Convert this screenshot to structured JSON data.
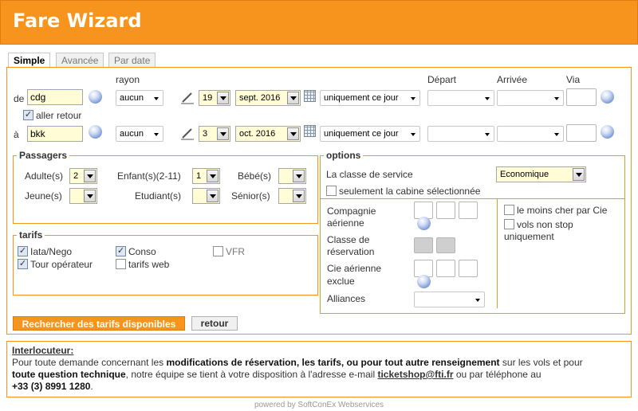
{
  "header": {
    "title": "Fare Wizard"
  },
  "tabs": [
    "Simple",
    "Avancée",
    "Par date"
  ],
  "columns": {
    "rayon": "rayon",
    "depart": "Départ",
    "arrivee": "Arrivée",
    "via": "Via"
  },
  "outbound": {
    "label": "de",
    "origin": "cdg",
    "rayon": "aucun",
    "day": "19",
    "month": "sept. 2016",
    "flex": "uniquement ce jour",
    "return_trip_label": "aller retour",
    "return_trip_checked": true
  },
  "inbound": {
    "label": "à",
    "origin": "bkk",
    "rayon": "aucun",
    "day": "3",
    "month": "oct. 2016",
    "flex": "uniquement ce jour"
  },
  "passengers": {
    "legend": "Passagers",
    "adults_label": "Adulte(s)",
    "adults": "2",
    "children_label": "Enfant(s)(2-11)",
    "children": "1",
    "babies_label": "Bébé(s)",
    "babies": "",
    "youth_label": "Jeune(s)",
    "youth": "",
    "students_label": "Etudiant(s)",
    "students": "",
    "seniors_label": "Sénior(s)",
    "seniors": ""
  },
  "options": {
    "legend": "options",
    "service_class_label": "La classe de service",
    "service_class": "Economique",
    "cabin_only_label": "seulement la cabine sélectionnée",
    "airline_label_1": "Compagnie",
    "airline_label_2": "aérienne",
    "booking_class_label_1": "Classe de",
    "booking_class_label_2": "réservation",
    "excluded_label_1": "Cie aérienne",
    "excluded_label_2": "exclue",
    "alliances_label": "Alliances",
    "cheapest_label": "le moins cher par Cie",
    "nonstop_label_1": "vols non stop",
    "nonstop_label_2": "uniquement"
  },
  "fares": {
    "legend": "tarifs",
    "items": [
      {
        "label": "Iata/Nego",
        "checked": true
      },
      {
        "label": "Conso",
        "checked": true
      },
      {
        "label": "VFR",
        "checked": false
      },
      {
        "label": "Tour opérateur",
        "checked": true
      },
      {
        "label": "tarifs web",
        "checked": false
      }
    ]
  },
  "buttons": {
    "search": "Rechercher des tarifs disponibles",
    "back": "retour"
  },
  "info": {
    "title": "Interlocuteur:",
    "p1": "Pour toute demande concernant les ",
    "b1": "modifications de réservation, les tarifs, ou pour tout autre renseignement",
    "p2": " sur les vols et pour",
    "b2": "toute question technique",
    "p3": ", notre équipe se tient à votre disposition à l'adresse e-mail ",
    "email": "ticketshop@fti.fr",
    "p4": " ou par téléphone au",
    "phone": "+33 (3) 8991 1280",
    "p5": "."
  },
  "footer": "powered by SoftConEx Webservices",
  "colors": {
    "accent": "#f7941d",
    "field_bg": "#fffcd6"
  }
}
